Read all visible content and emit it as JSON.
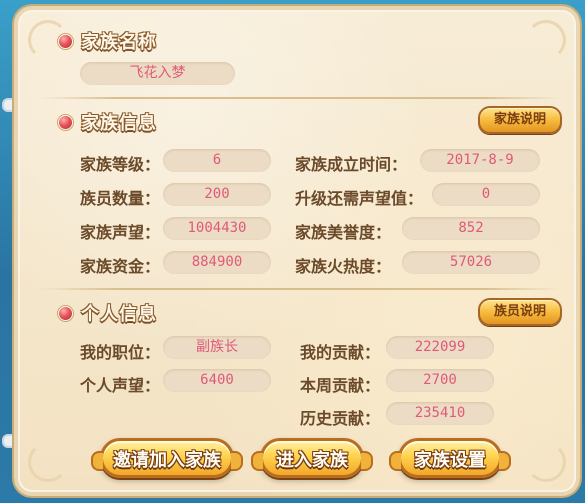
{
  "family_name": {
    "title": "家族名称",
    "value": "飞花入梦"
  },
  "family_info": {
    "title": "家族信息",
    "help_button": "家族说明",
    "rows": [
      {
        "left_label": "家族等级：",
        "left_value": "6",
        "right_label": "家族成立时间：",
        "right_value": "2017-8-9"
      },
      {
        "left_label": "族员数量：",
        "left_value": "200",
        "right_label": "升级还需声望值：",
        "right_value": "0"
      },
      {
        "left_label": "家族声望：",
        "left_value": "1004430",
        "right_label": "家族美誉度：",
        "right_value": "852"
      },
      {
        "left_label": "家族资金：",
        "left_value": "884900",
        "right_label": "家族火热度：",
        "right_value": "57026"
      }
    ]
  },
  "personal_info": {
    "title": "个人信息",
    "help_button": "族员说明",
    "position_label": "我的职位：",
    "position_value": "副族长",
    "reputation_label": "个人声望：",
    "reputation_value": "6400",
    "contribution_label": "我的贡献：",
    "contribution_value": "222099",
    "weekly_label": "本周贡献：",
    "weekly_value": "2700",
    "history_label": "历史贡献：",
    "history_value": "235410"
  },
  "actions": {
    "invite": "邀请加入家族",
    "enter": "进入家族",
    "settings": "家族设置"
  },
  "colors": {
    "panel_bg": "#f3e2c2",
    "label_text": "#6b4a2a",
    "value_text": "#e05a78",
    "button_gold": "#ffd24b",
    "bullet_red": "#e8545a"
  }
}
